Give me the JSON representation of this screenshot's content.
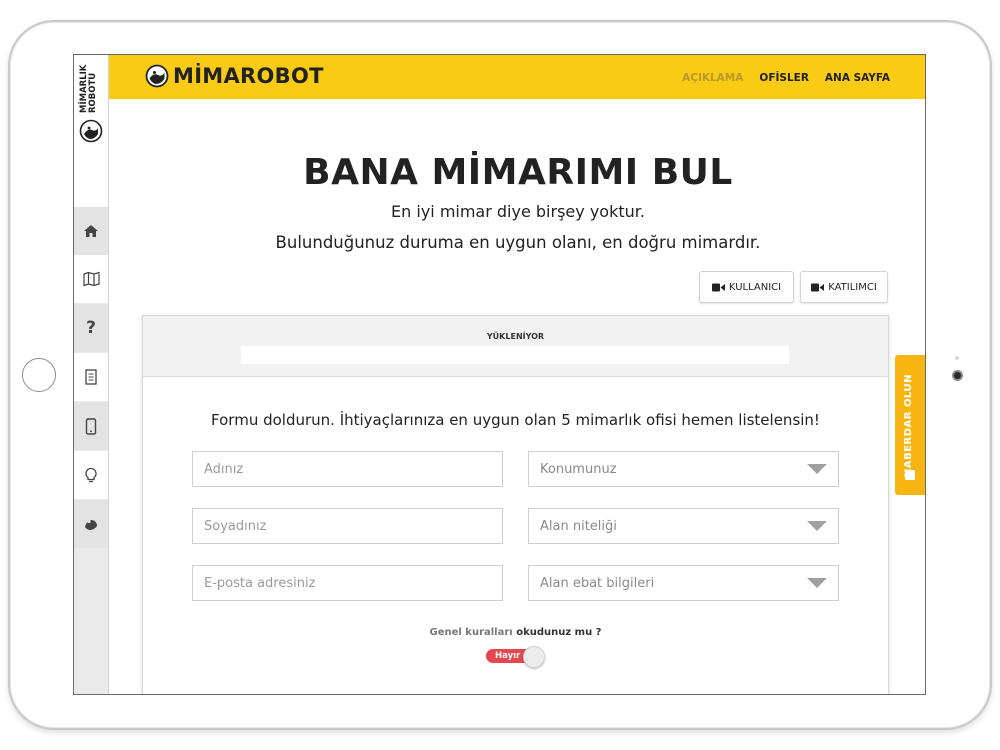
{
  "brand": {
    "name": "MİMAROBOT",
    "side_logo": "MİMARLIK\nROBOTU"
  },
  "nav": {
    "items": [
      "AÇIKLAMA",
      "OFİSLER",
      "ANA SAYFA"
    ]
  },
  "sidebar": {
    "items": [
      {
        "icon": "home-icon"
      },
      {
        "icon": "map-icon"
      },
      {
        "icon": "question-icon",
        "label": "?"
      },
      {
        "icon": "document-icon"
      },
      {
        "icon": "mobile-icon"
      },
      {
        "icon": "lightbulb-icon"
      },
      {
        "icon": "robot-icon"
      }
    ]
  },
  "hero": {
    "title": "BANA MİMARIMI BUL",
    "subtitle1": "En iyi mimar diye birşey yoktur.",
    "subtitle2": "Bulunduğunuz duruma en uygun olanı, en doğru mimardır."
  },
  "video_buttons": {
    "user": "KULLANICI",
    "participant": "KATILIMCI"
  },
  "loading": {
    "label": "YÜKLENİYOR"
  },
  "form": {
    "heading": "Formu doldurun. İhtiyaçlarınıza en uygun olan 5 mimarlık ofisi hemen listelensin!",
    "first_name_placeholder": "Adınız",
    "last_name_placeholder": "Soyadınız",
    "email_placeholder": "E-posta adresiniz",
    "location": "Konumunuz",
    "area_type": "Alan niteliği",
    "area_size": "Alan ebat bilgileri",
    "rules_prefix": "Genel kuralları",
    "rules_suffix": "okudunuz mu ?",
    "toggle_label": "Hayır"
  },
  "side_tab": {
    "label": "HABERDAR OLUN"
  },
  "colors": {
    "accent": "#f9cb14",
    "tab": "#f9b612",
    "toggle": "#e5474f"
  }
}
